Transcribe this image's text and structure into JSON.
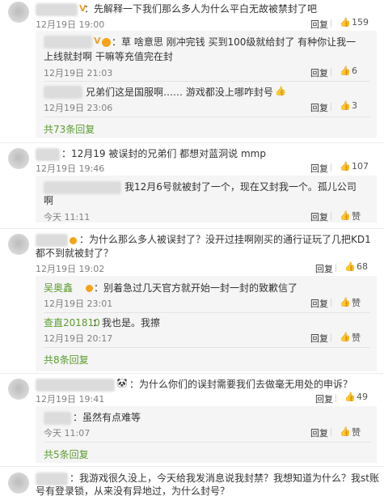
{
  "c1": {
    "text": "：先解释一下我们那么多人为什么平白无故被禁封了吧",
    "time": "12月19日 19:00",
    "reply": "回复",
    "likes": "159",
    "subs": [
      {
        "text1": "：草 啥意思 刚冲完钱 买到100级就给封了 有种你让我一",
        "text2": "上线就封啊 干嘛等充值完在封",
        "time": "12月19日 21:03",
        "reply": "回复",
        "likes": "6"
      },
      {
        "text1": "兄弟们这是国服啊…… 游戏都没上哪咋封号",
        "time": "12月19日 23:06",
        "reply": "回复",
        "likes": "3"
      }
    ],
    "more": "共73条回复"
  },
  "c2": {
    "text": "：12月19 被误封的兄弟们 都想对蓝洞说 mmp",
    "time": "12月19日 19:46",
    "reply": "回复",
    "likes": "107",
    "subs": [
      {
        "text1": "我12月6号就被封了一个，现在又封我一个。孤儿公司",
        "text2": "啊",
        "time": "今天 11:11",
        "reply": "回复",
        "likes": "赞"
      }
    ]
  },
  "c3": {
    "text1": "：为什么那么多人被误封了？没开过挂啊刚买的通行证玩了几把KD1",
    "text2": "都不到就被封了？",
    "time": "12月19日 19:02",
    "reply": "回复",
    "likes": "68",
    "subs": [
      {
        "user": "吴奥鑫",
        "text1": "：别着急过几天官方就开始一封一封的致歉信了",
        "time": "12月19日 23:01",
        "reply": "回复",
        "likes": "赞"
      },
      {
        "user": "查直201810",
        "text1": "：我也是。我擦",
        "time": "12月19日 20:17",
        "reply": "回复",
        "likes": "赞"
      }
    ],
    "more": "共8条回复"
  },
  "c4": {
    "text": "：为什么你们的误封需要我们去做毫无用处的申诉？",
    "time": "12月19日 19:41",
    "reply": "回复",
    "likes": "49",
    "subs": [
      {
        "text1": "：虽然有点难等",
        "time": "今天 11:07",
        "reply": "回复",
        "likes": "赞"
      }
    ],
    "more": "共5条回复"
  },
  "c5": {
    "text1": "：我游戏很久没上，今天给我发消息说我封禁？我想知道为什么？我st账",
    "text2": "号有登录锁，从来没有异地过，为什么封号？"
  },
  "colors": {
    "link_green": "#5b9c31",
    "badge_orange": "#f5a31a"
  },
  "icons": {
    "like": "thumbs-up-icon",
    "badge": "vip-badge-icon"
  }
}
